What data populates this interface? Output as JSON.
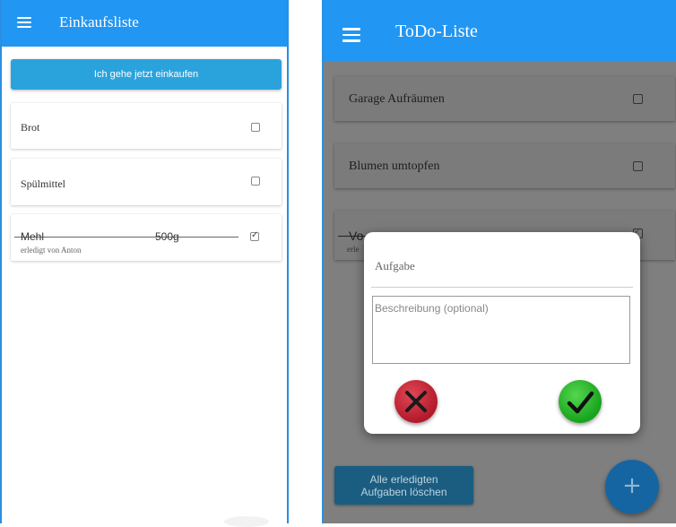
{
  "shopping": {
    "title": "Einkaufsliste",
    "shop_button_label": "Ich gehe jetzt einkaufen",
    "items": [
      {
        "name": "Brot",
        "checked": false
      },
      {
        "name": "Spülmittel",
        "checked": false
      },
      {
        "name": "Mehl",
        "amount": "500g",
        "checked": true,
        "done_by": "erledigt von Anton"
      }
    ]
  },
  "todo": {
    "title": "ToDo-Liste",
    "items": [
      {
        "name": "Garage Aufräumen",
        "checked": false
      },
      {
        "name": "Blumen umtopfen",
        "checked": false
      },
      {
        "name_partial": "Vo",
        "sub_partial": "erle",
        "checked": true
      }
    ],
    "dialog": {
      "title": "Aufgabe",
      "description_placeholder": "Beschreibung (optional)"
    },
    "delete_button_line1": "Alle erledigten",
    "delete_button_line2": "Aufgaben löschen",
    "fab_label": "+"
  },
  "colors": {
    "appbar": "#2196f3",
    "shop_button": "#2aa3dd",
    "cancel": "#c8243a",
    "confirm": "#2db82b"
  },
  "icons": [
    "menu-icon",
    "checkbox-icon",
    "cancel-x-icon",
    "confirm-check-icon",
    "plus-icon"
  ]
}
